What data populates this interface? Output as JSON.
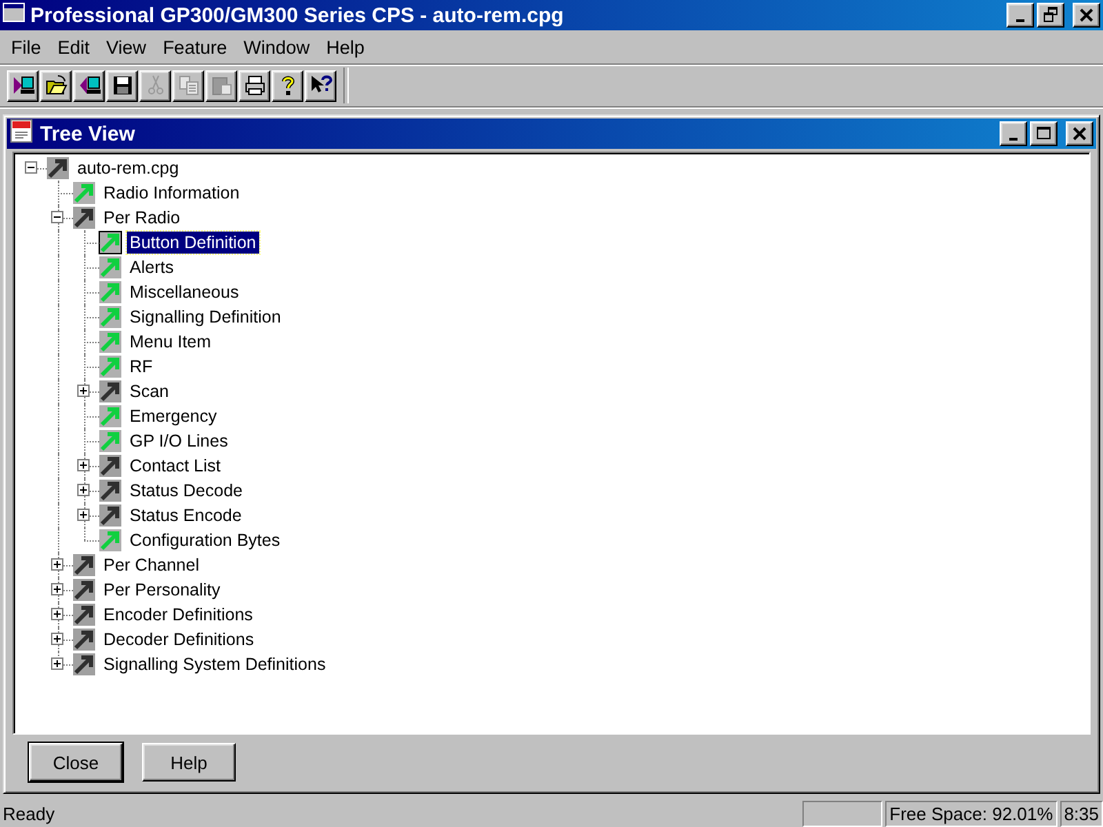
{
  "window": {
    "title": "Professional GP300/GM300 Series CPS - auto-rem.cpg"
  },
  "menu": [
    "File",
    "Edit",
    "View",
    "Feature",
    "Window",
    "Help"
  ],
  "toolbar": [
    {
      "kind": "new",
      "disabled": false
    },
    {
      "kind": "open",
      "disabled": false
    },
    {
      "kind": "close",
      "disabled": false
    },
    {
      "kind": "save",
      "disabled": false
    },
    {
      "kind": "cut",
      "disabled": true
    },
    {
      "kind": "copy",
      "disabled": true
    },
    {
      "kind": "paste",
      "disabled": true
    },
    {
      "kind": "print",
      "disabled": false
    },
    {
      "kind": "help",
      "disabled": false
    },
    {
      "kind": "context-help",
      "disabled": false
    }
  ],
  "child_window": {
    "title": "Tree View"
  },
  "tree": {
    "items": [
      {
        "label": "auto-rem.cpg",
        "kind": "group",
        "expanded": true,
        "selected": false,
        "children": [
          {
            "label": "Radio Information",
            "kind": "item",
            "selected": false
          },
          {
            "label": "Per Radio",
            "kind": "group",
            "expanded": true,
            "selected": false,
            "children": [
              {
                "label": "Button Definition",
                "kind": "item",
                "selected": true
              },
              {
                "label": "Alerts",
                "kind": "item",
                "selected": false
              },
              {
                "label": "Miscellaneous",
                "kind": "item",
                "selected": false
              },
              {
                "label": "Signalling Definition",
                "kind": "item",
                "selected": false
              },
              {
                "label": "Menu Item",
                "kind": "item",
                "selected": false
              },
              {
                "label": "RF",
                "kind": "item",
                "selected": false
              },
              {
                "label": "Scan",
                "kind": "group",
                "expanded": false,
                "selected": false
              },
              {
                "label": "Emergency",
                "kind": "item",
                "selected": false
              },
              {
                "label": "GP I/O Lines",
                "kind": "item",
                "selected": false
              },
              {
                "label": "Contact List",
                "kind": "group",
                "expanded": false,
                "selected": false
              },
              {
                "label": "Status Decode",
                "kind": "group",
                "expanded": false,
                "selected": false
              },
              {
                "label": "Status Encode",
                "kind": "group",
                "expanded": false,
                "selected": false
              },
              {
                "label": "Configuration Bytes",
                "kind": "item",
                "selected": false
              }
            ]
          },
          {
            "label": "Per Channel",
            "kind": "group",
            "expanded": false,
            "selected": false
          },
          {
            "label": "Per Personality",
            "kind": "group",
            "expanded": false,
            "selected": false
          },
          {
            "label": "Encoder Definitions",
            "kind": "group",
            "expanded": false,
            "selected": false
          },
          {
            "label": "Decoder Definitions",
            "kind": "group",
            "expanded": false,
            "selected": false
          },
          {
            "label": "Signalling System Definitions",
            "kind": "group",
            "expanded": false,
            "selected": false
          }
        ]
      }
    ]
  },
  "buttons": [
    "Close",
    "Help"
  ],
  "status_bar": {
    "message": "Ready",
    "free_space": "Free Space: 92.01%",
    "time": "8:35"
  }
}
